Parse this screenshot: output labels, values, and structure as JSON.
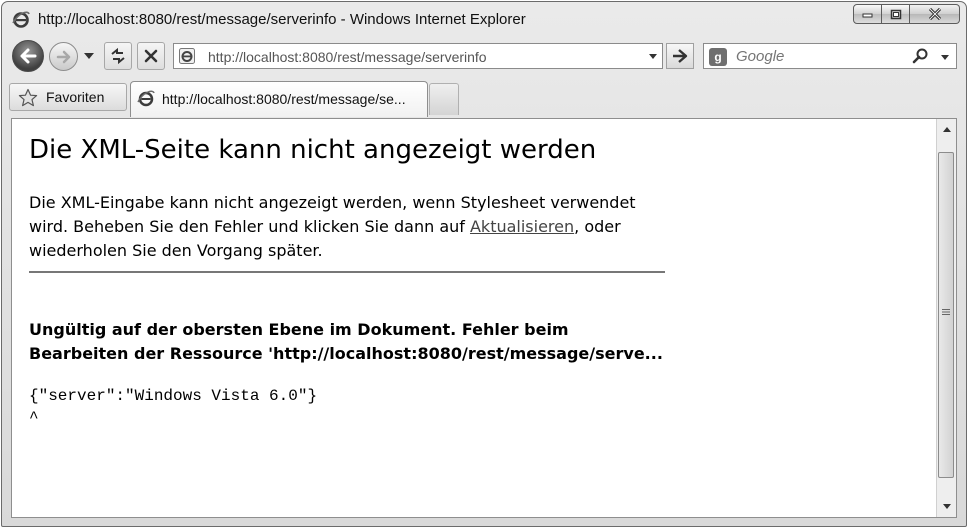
{
  "window": {
    "title": "http://localhost:8080/rest/message/serverinfo - Windows Internet Explorer"
  },
  "toolbar": {
    "address_url": "http://localhost:8080/rest/message/serverinfo",
    "search_placeholder": "Google"
  },
  "favorites": {
    "label": "Favoriten"
  },
  "tabs": [
    {
      "label": "http://localhost:8080/rest/message/se..."
    }
  ],
  "page": {
    "heading": "Die XML-Seite kann nicht angezeigt werden",
    "message_part1": "Die XML-Eingabe kann nicht angezeigt werden, wenn Stylesheet verwendet wird. Beheben Sie den Fehler und klicken Sie dann auf ",
    "refresh_link": "Aktualisieren",
    "message_part2": ", oder wiederholen Sie den Vorgang später.",
    "error_text": "Ungültig auf der obersten Ebene im Dokument. Fehler beim Bearbeiten der Ressource 'http://localhost:8080/rest/message/serve...",
    "source_line": "{\"server\":\"Windows Vista 6.0\"}",
    "caret_line": "^"
  }
}
